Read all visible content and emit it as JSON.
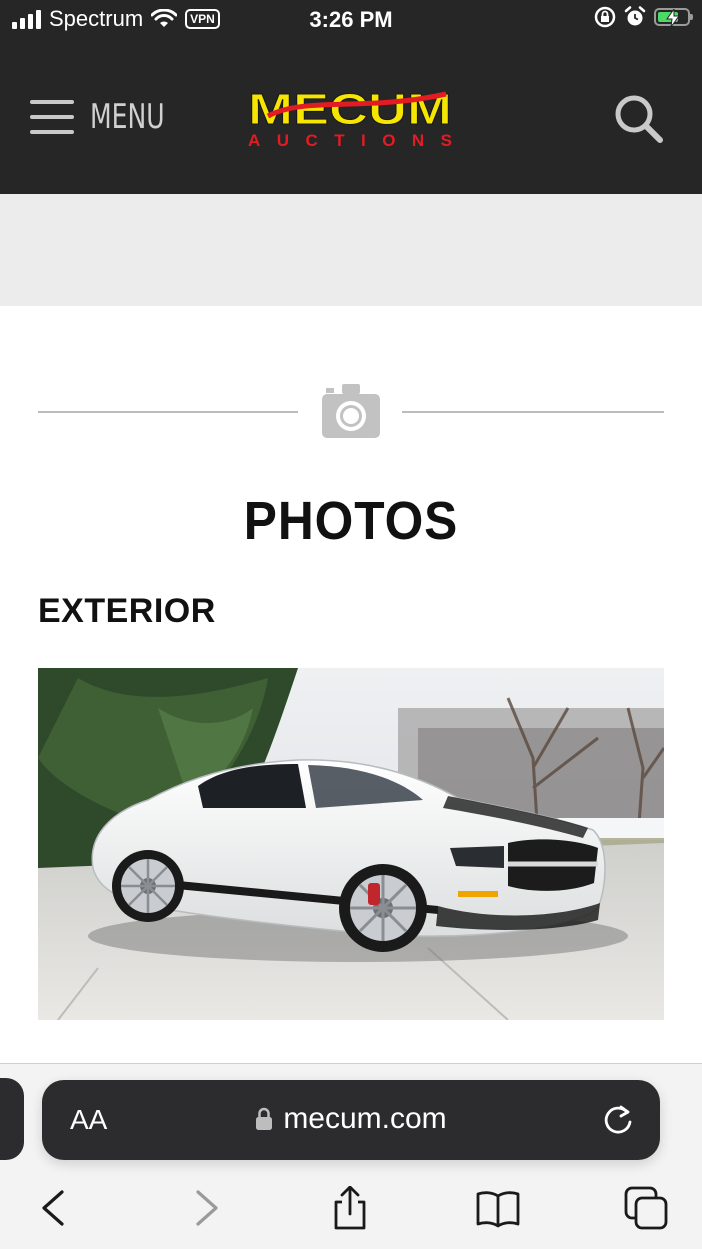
{
  "status_bar": {
    "carrier": "Spectrum",
    "vpn_label": "VPN",
    "time": "3:26 PM",
    "battery_level": 0.7,
    "icons": [
      "signal-icon",
      "wifi-icon",
      "vpn-badge",
      "orientation-lock-icon",
      "alarm-icon",
      "battery-charging-icon"
    ]
  },
  "header": {
    "menu_label": "MENU",
    "logo_text": "MECUM",
    "logo_subtext": "AUCTIONS",
    "icons": [
      "hamburger-icon",
      "search-icon"
    ],
    "colors": {
      "background": "#262626",
      "logo_yellow": "#f5e500",
      "logo_red": "#e31b23"
    }
  },
  "main": {
    "section_title": "PHOTOS",
    "subsection_title": "EXTERIOR",
    "section_icon": "camera-icon",
    "photo_alt": "White Ford Shelby GT500 with black stripes parked on concrete"
  },
  "safari": {
    "aa_label": "AA",
    "url": "mecum.com",
    "icons": [
      "lock-icon",
      "reload-icon",
      "back-icon",
      "forward-icon",
      "share-icon",
      "bookmarks-icon",
      "tabs-icon"
    ]
  }
}
